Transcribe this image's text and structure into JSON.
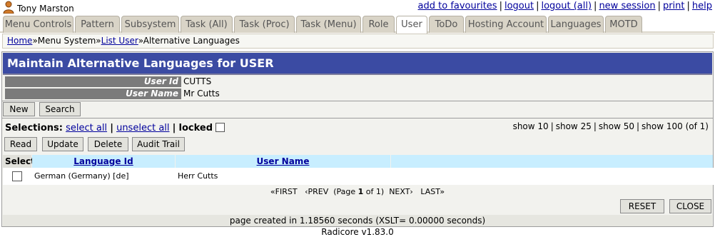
{
  "user": {
    "name": "Tony Marston"
  },
  "top_links": [
    "add to favourites",
    "logout",
    "logout (all)",
    "new session",
    "print",
    "help"
  ],
  "tabs": [
    {
      "label": "Menu Controls",
      "active": false
    },
    {
      "label": "Pattern",
      "active": false
    },
    {
      "label": "Subsystem",
      "active": false
    },
    {
      "label": "Task (All)",
      "active": false
    },
    {
      "label": "Task (Proc)",
      "active": false
    },
    {
      "label": "Task (Menu)",
      "active": false
    },
    {
      "label": "Role",
      "active": false
    },
    {
      "label": "User",
      "active": true
    },
    {
      "label": "ToDo",
      "active": false
    },
    {
      "label": "Hosting Account",
      "active": false
    },
    {
      "label": "Languages",
      "active": false
    },
    {
      "label": "MOTD",
      "active": false
    }
  ],
  "breadcrumb": {
    "items": [
      "Home",
      "Menu System",
      "List User",
      "Alternative Languages"
    ],
    "separator": "»"
  },
  "page_title": "Maintain Alternative Languages for USER",
  "details": [
    {
      "label": "User Id",
      "value": "CUTTS"
    },
    {
      "label": "User Name",
      "value": "Mr Cutts"
    }
  ],
  "buttons_top": {
    "new": "New",
    "search": "Search"
  },
  "selections": {
    "label": "Selections:",
    "select_all": "select all",
    "unselect_all": "unselect all",
    "locked": "locked"
  },
  "show": {
    "s10": "show 10",
    "s25": "show 25",
    "s50": "show 50",
    "s100": "show 100",
    "count": "(of 1)"
  },
  "buttons_action": {
    "read": "Read",
    "update": "Update",
    "delete": "Delete",
    "audit": "Audit Trail"
  },
  "table": {
    "headers": {
      "select": "Select",
      "language_id": "Language Id",
      "user_name": "User Name"
    },
    "rows": [
      {
        "language_id": "German (Germany) [de]",
        "user_name": "Herr Cutts"
      }
    ]
  },
  "pagination": {
    "first": "«FIRST",
    "prev": "‹PREV",
    "page_label": "(Page",
    "page": "1",
    "of": "of 1)",
    "next": "NEXT›",
    "last": "LAST»"
  },
  "buttons_bottom": {
    "reset": "RESET",
    "close": "CLOSE"
  },
  "footer": {
    "timing": "page created in 1.18560 seconds (XSLT= 0.00000 seconds)"
  },
  "version": "Radicore v1.83.0",
  "colors": {
    "title_bar": "#3b4ba3",
    "link": "#00009c",
    "tab_bg": "#d9d4c7",
    "label_bg": "#7b7b7b",
    "header_bg": "#c8eeff"
  }
}
